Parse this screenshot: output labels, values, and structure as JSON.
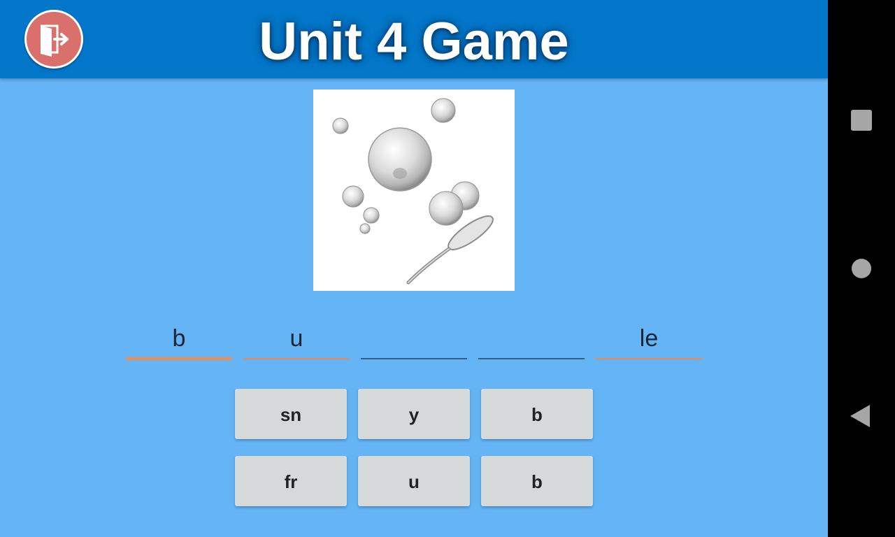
{
  "header": {
    "title": "Unit 4 Game",
    "exit_icon": "exit-door-icon",
    "bar_color": "#0277c9",
    "exit_color": "#d9706c"
  },
  "picture": {
    "icon": "soap-bubbles-wand-illustration"
  },
  "word_slots": [
    {
      "text": "b",
      "state": "active"
    },
    {
      "text": "u",
      "state": "filled"
    },
    {
      "text": "",
      "state": "empty"
    },
    {
      "text": "",
      "state": "empty"
    },
    {
      "text": "le",
      "state": "filled"
    }
  ],
  "choices": [
    {
      "label": "sn"
    },
    {
      "label": "y"
    },
    {
      "label": "b"
    },
    {
      "label": "fr"
    },
    {
      "label": "u"
    },
    {
      "label": "b"
    }
  ],
  "colors": {
    "background": "#64b4f6",
    "slot_underline_filled": "#f08a4b",
    "slot_underline_empty": "#355c8a",
    "choice_button": "#d6d9da"
  },
  "system_nav": {
    "recents_icon": "square-recents-icon",
    "home_icon": "circle-home-icon",
    "back_icon": "triangle-back-icon"
  }
}
